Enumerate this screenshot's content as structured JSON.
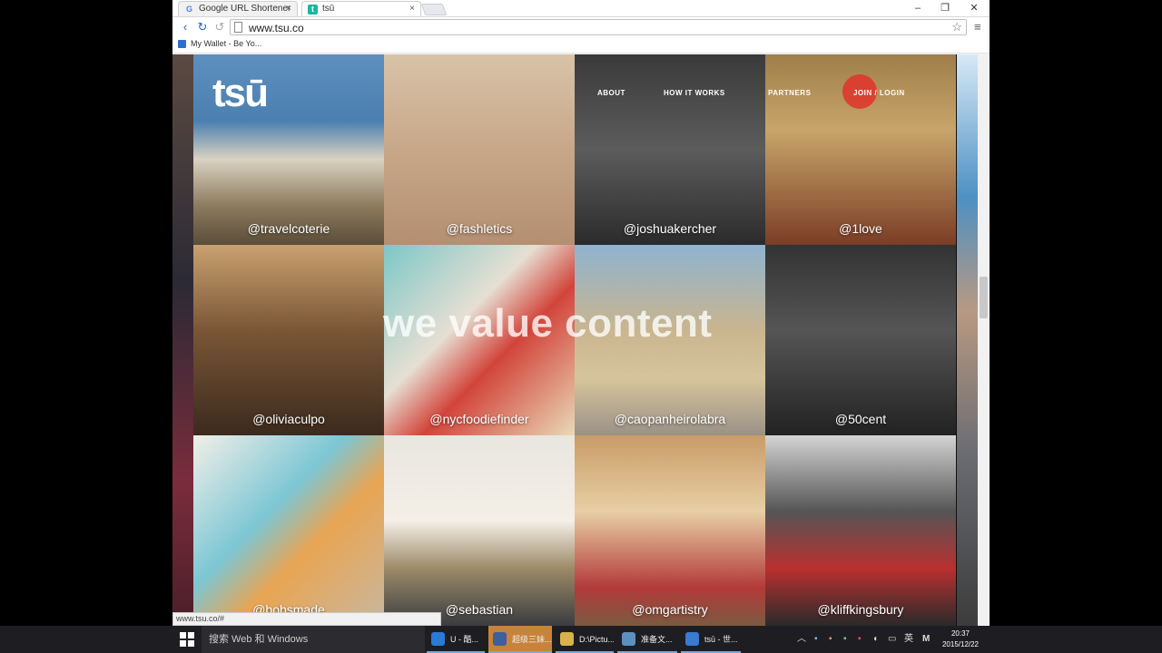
{
  "browser": {
    "tabs": [
      {
        "title": "Google URL Shortener",
        "favicon": "google-icon",
        "active": false
      },
      {
        "title": "tsū",
        "favicon": "tsu-icon",
        "active": true
      }
    ],
    "address": "www.tsu.co",
    "bookmarks": [
      {
        "label": "My Wallet - Be Yo..."
      }
    ],
    "status_url": "www.tsu.co/#"
  },
  "site": {
    "logo": "tsū",
    "nav": [
      {
        "label": "ABOUT"
      },
      {
        "label": "HOW IT WORKS"
      },
      {
        "label": "PARTNERS"
      },
      {
        "label": "JOIN / LOGIN"
      }
    ],
    "slogan": "we value content",
    "tiles": [
      {
        "handle": "@travelcoterie",
        "bg": "linear-gradient(#5e8fbf 0%,#4b7fb0 35%,#d9d2c2 55%,#8b7a5c 80%,#5a4d3a 100%)"
      },
      {
        "handle": "@fashletics",
        "bg": "linear-gradient(#d8c3a8 0%,#c8a789 50%,#b48f72 100%)"
      },
      {
        "handle": "@joshuakercher",
        "bg": "linear-gradient(#3a3a3a 0%,#5c5c5c 50%,#2b2b2b 100%)"
      },
      {
        "handle": "@1love",
        "bg": "linear-gradient(#a07e4a 0%,#c7a56a 40%,#7a3d26 100%)"
      },
      {
        "handle": "@oliviaculpo",
        "bg": "linear-gradient(#c9a171 0%,#7a5636 45%,#3b2a1e 100%)"
      },
      {
        "handle": "@nycfoodiefinder",
        "bg": "linear-gradient(135deg,#7cc7c7 0%,#e6dfd3 40%,#d2443a 60%,#e9d9b8 100%)"
      },
      {
        "handle": "@caopanheirolabra",
        "bg": "linear-gradient(#8fb3cf 0%,#c9b58f 45%,#d6c59c 70%,#9a9187 100%)"
      },
      {
        "handle": "@50cent",
        "bg": "linear-gradient(#333 0%,#555 45%,#222 100%)"
      },
      {
        "handle": "@bobsmade",
        "bg": "linear-gradient(135deg,#f2efe8 0%,#7cc7d4 40%,#e8a552 60%,#c9b7a1 100%)"
      },
      {
        "handle": "@sebastian",
        "bg": "linear-gradient(#e9e6e0 0%,#f4efe7 45%,#9c8a68 70%,#3a3c40 100%)"
      },
      {
        "handle": "@omgartistry",
        "bg": "linear-gradient(#c89c67 0%,#e8cfa5 40%,#b33a3a 80%,#7a5a40 100%)"
      },
      {
        "handle": "@kliffkingsbury",
        "bg": "linear-gradient(#d4d4d4 0%,#555 40%,#b93030 70%,#2a2a2a 100%)"
      }
    ]
  },
  "taskbar": {
    "search_placeholder": "搜索 Web 和 Windows",
    "tasks": [
      {
        "label": "U - 酷...",
        "color": "#2a7ad8"
      },
      {
        "label": "超级三妹...",
        "color": "#3d5f9d"
      },
      {
        "label": "D:\\Pictu...",
        "color": "#d8b34a"
      },
      {
        "label": "准备文...",
        "color": "#5d8fbf"
      },
      {
        "label": "tsū - 世...",
        "color": "#3a7ad0"
      }
    ],
    "ime": "英",
    "time": "20:37",
    "date": "2015/12/22"
  }
}
